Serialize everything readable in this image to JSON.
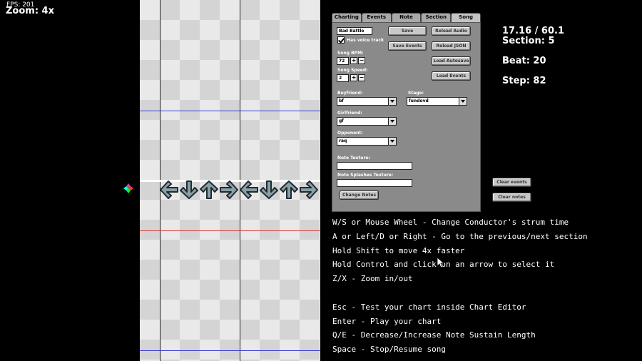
{
  "hud": {
    "fps": "FPS: 201",
    "zoom": "Zoom: 4x"
  },
  "panel": {
    "tabs": [
      "Charting",
      "Events",
      "Note",
      "Section",
      "Song"
    ],
    "active_tab": "Song",
    "song_name": "Bad Battle",
    "has_voice_track_label": "Has voice track",
    "has_voice_track": true,
    "song_bpm_label": "Song BPM:",
    "song_bpm": "72",
    "song_speed_label": "Song Speed:",
    "song_speed": "2",
    "boyfriend_label": "Boyfriend:",
    "boyfriend": "bf",
    "stage_label": "Stage:",
    "stage": "fundovd",
    "girlfriend_label": "Girlfriend:",
    "girlfriend": "gf",
    "opponent_label": "Opponent:",
    "opponent": "raq",
    "note_texture_label": "Note Texture:",
    "note_texture": "",
    "note_splashes_label": "Note Splashes Texture:",
    "note_splashes": "",
    "buttons": {
      "save": "Save",
      "reload_audio": "Reload Audio",
      "save_events": "Save Events",
      "reload_json": "Reload JSON",
      "load_autosave": "Load Autosave",
      "load_events": "Load Events",
      "change_notes": "Change Notes"
    },
    "plus": "+",
    "minus": "−"
  },
  "info": {
    "time": "17.16 / 60.1",
    "section": "Section: 5",
    "beat": "Beat: 20",
    "step": "Step: 82"
  },
  "side_buttons": {
    "clear_events": "Clear events",
    "clear_notes": "Clear notes"
  },
  "help_lines": [
    "W/S or Mouse Wheel - Change Conductor's strum time",
    "A or Left/D or Right - Go to the previous/next section",
    "Hold Shift to move 4x faster",
    "Hold Control and click on an arrow to select it",
    "Z/X - Zoom in/out",
    "",
    "Esc - Test your chart inside Chart Editor",
    "Enter - Play your chart",
    "Q/E - Decrease/Increase Note Sustain Length",
    "Space - Stop/Resume song"
  ],
  "colors": {
    "section_line_blue": "#3a3ad8",
    "section_line_red": "#d83a3a",
    "arrow_fill": "#8a9ea6",
    "arrow_stroke": "#1e2a30"
  },
  "strum_arrows": [
    "left",
    "down",
    "up",
    "right",
    "left",
    "down",
    "up",
    "right"
  ]
}
